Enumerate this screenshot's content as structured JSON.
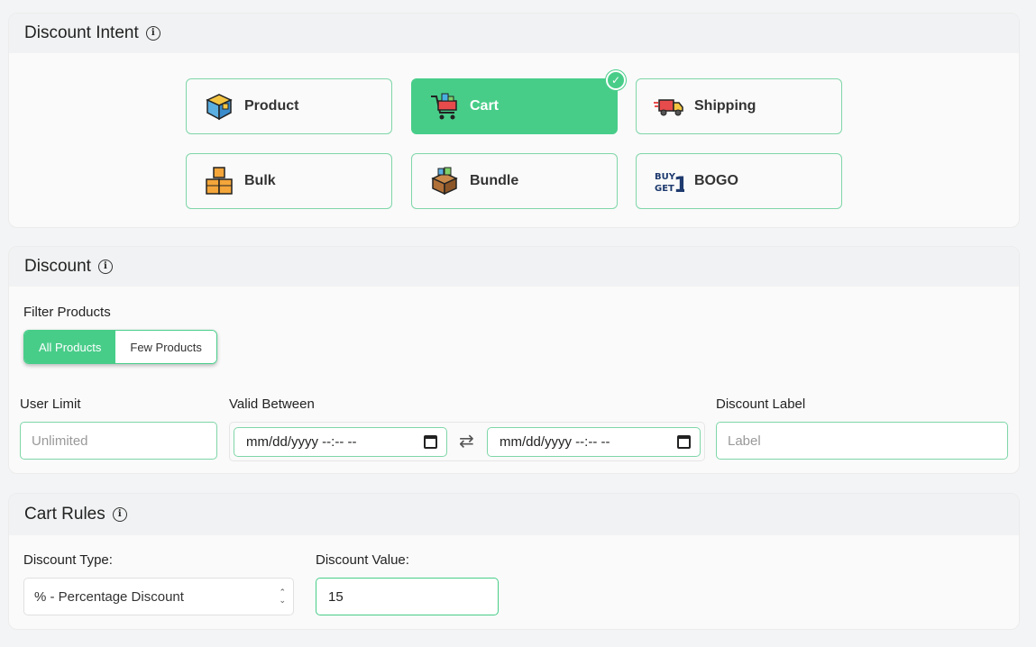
{
  "discount_intent": {
    "title": "Discount Intent",
    "info_icon": "info-icon",
    "options": [
      {
        "label": "Product",
        "icon": "product-box-icon",
        "selected": false
      },
      {
        "label": "Cart",
        "icon": "shopping-cart-icon",
        "selected": true
      },
      {
        "label": "Shipping",
        "icon": "delivery-truck-icon",
        "selected": false
      },
      {
        "label": "Bulk",
        "icon": "stacked-boxes-icon",
        "selected": false
      },
      {
        "label": "Bundle",
        "icon": "bundle-box-icon",
        "selected": false
      },
      {
        "label": "BOGO",
        "icon": "buy-get-one-icon",
        "selected": false
      }
    ],
    "accent_color": "#48cd89"
  },
  "discount": {
    "title": "Discount",
    "filter_products_label": "Filter Products",
    "filter_options": [
      "All Products",
      "Few Products"
    ],
    "filter_selected": "All Products",
    "user_limit_label": "User Limit",
    "user_limit_placeholder": "Unlimited",
    "valid_between_label": "Valid Between",
    "date_placeholder": "mm/dd/yyyy --:-- --",
    "discount_label_label": "Discount Label",
    "discount_label_placeholder": "Label"
  },
  "cart_rules": {
    "title": "Cart Rules",
    "discount_type_label": "Discount Type:",
    "discount_type_value": "% - Percentage Discount",
    "discount_value_label": "Discount Value:",
    "discount_value": "15"
  }
}
